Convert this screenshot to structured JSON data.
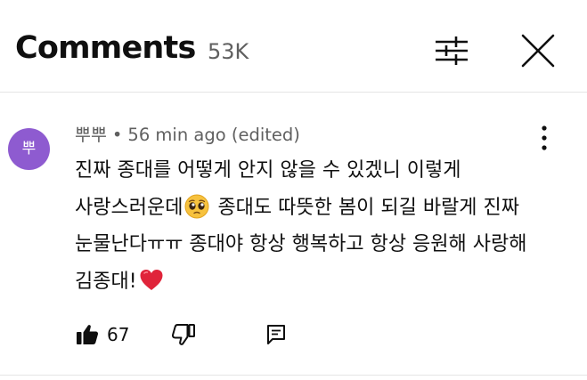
{
  "header": {
    "title": "Comments",
    "count": "53K",
    "filter_icon": "sort-sliders-icon",
    "close_icon": "close-icon"
  },
  "comment": {
    "avatar_letter": "뿌",
    "avatar_color": "#8e5bd0",
    "author": "뿌뿌",
    "separator": "•",
    "time": "56 min ago",
    "edited": "(edited)",
    "text_part1": "진짜 종대를 어떻게 안지 않을 수 있겠니 이렇게 사랑스러운데",
    "text_part2": " 종대도 따뜻한 봄이 되길 바랄게 진짜 눈물난다ㅠㅠ 종대야 항상 행복하고 항상 응원해 사랑해 김종대!",
    "emoji_1": "pleading-face-emoji",
    "emoji_2": "red-heart-emoji",
    "like_count": "67",
    "like_icon": "thumbs-up-filled-icon",
    "dislike_icon": "thumbs-down-outline-icon",
    "reply_icon": "reply-comment-icon",
    "menu_icon": "more-vertical-icon"
  }
}
